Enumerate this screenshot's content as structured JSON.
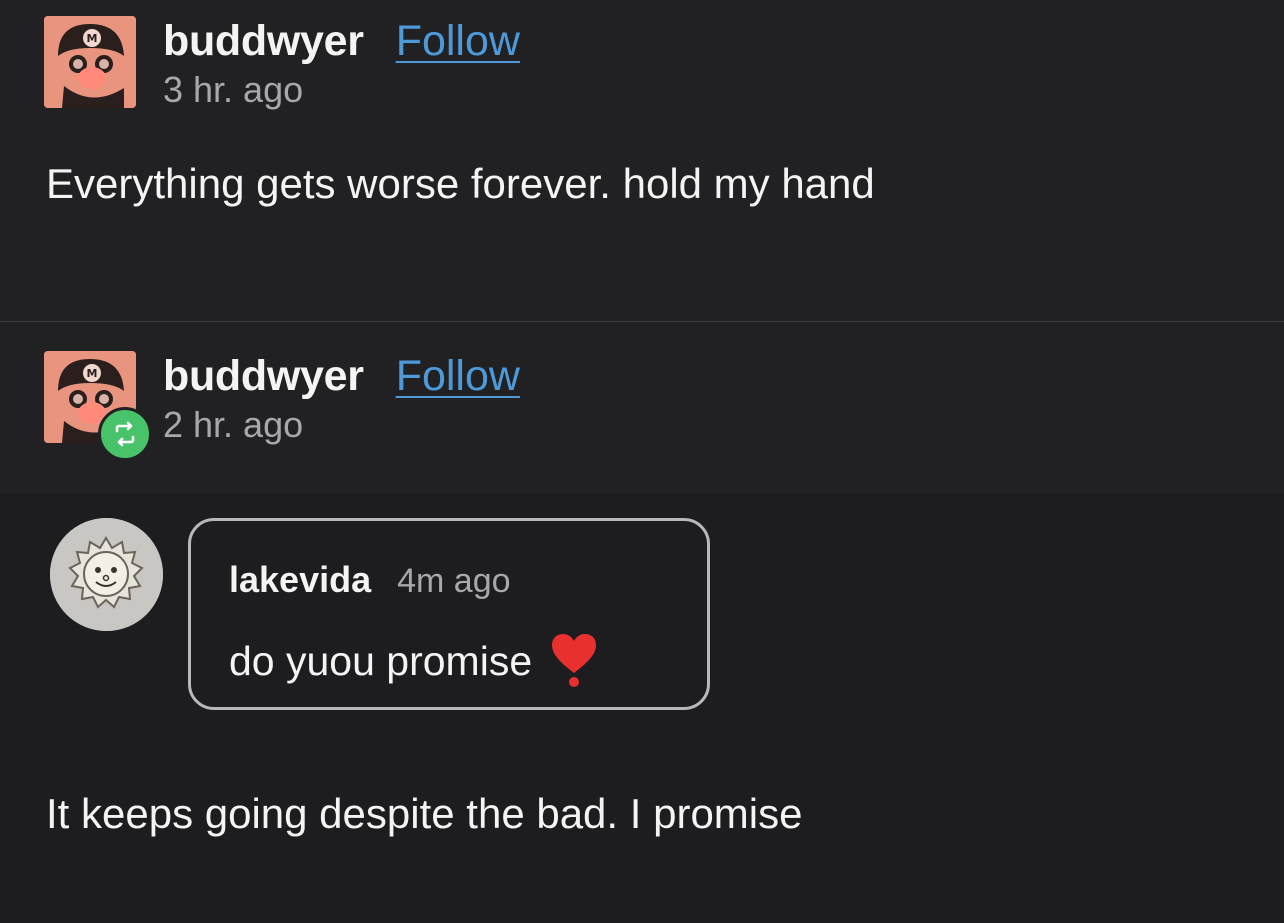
{
  "posts": [
    {
      "username": "buddwyer",
      "follow_label": "Follow",
      "timestamp": "3 hr. ago",
      "avatar_icon": "mario-avatar",
      "body": "Everything gets worse forever. hold my hand"
    },
    {
      "username": "buddwyer",
      "follow_label": "Follow",
      "timestamp": "2 hr. ago",
      "avatar_icon": "mario-avatar",
      "badge_icon": "reblog-icon",
      "badge_color": "#48c36a",
      "comment": {
        "username": "lakevida",
        "timestamp": "4m ago",
        "text": "do yuou promise",
        "emoji_icon": "red-heart-exclamation-icon",
        "avatar_icon": "sun-face-avatar"
      },
      "body": "It keeps going despite the bad. I promise"
    }
  ],
  "colors": {
    "background": "#212123",
    "follow_link": "#4e9ad9",
    "secondary_text": "#a8a8ab"
  }
}
